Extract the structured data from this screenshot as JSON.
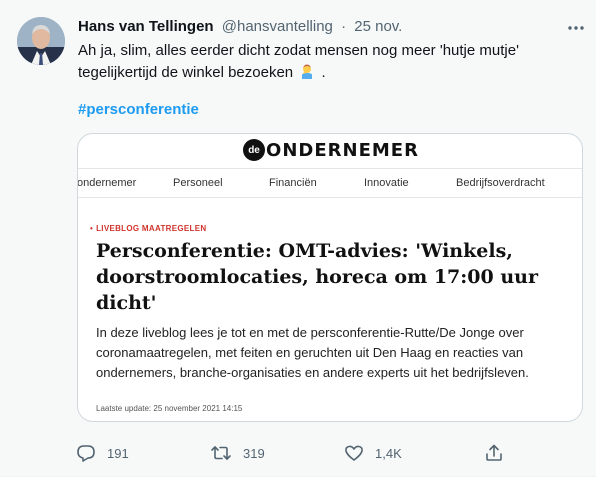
{
  "tweet": {
    "author_name": "Hans van Tellingen",
    "handle": "@hansvantelling",
    "separator": "·",
    "date": "25 nov.",
    "text_before_emoji": "Ah ja, slim, alles eerder dicht zodat mensen nog meer 'hutje mutje' tegelijkertijd de winkel bezoeken",
    "text_after_emoji": ".",
    "emoji_icon": "person-facepalming-icon",
    "hashtag": "#persconferentie"
  },
  "card": {
    "logo_badge": "de",
    "logo_text": "ONDERNEMER",
    "nav": [
      "ondernemer",
      "Personeel",
      "Financiën",
      "Innovatie",
      "Bedrijfsoverdracht"
    ],
    "live_tag": "LIVEBLOG MAATREGELEN",
    "live_bullet": "•",
    "headline": "Persconferentie: OMT-advies: 'Winkels, doorstroomlocaties, horeca om 17:00 uur dicht'",
    "summary": "In deze liveblog lees je tot en met de persconferentie-Rutte/De Jonge over coronamaatregelen, met feiten en geruchten uit Den Haag en reacties van ondernemers, branche-organisaties en andere experts uit het bedrijfsleven.",
    "updated": "Laatste update: 25 november 2021 14:15"
  },
  "actions": {
    "replies": "191",
    "retweets": "319",
    "likes": "1,4K"
  },
  "colors": {
    "link": "#1d9bf0",
    "muted": "#536471",
    "live_red": "#d0332c"
  }
}
